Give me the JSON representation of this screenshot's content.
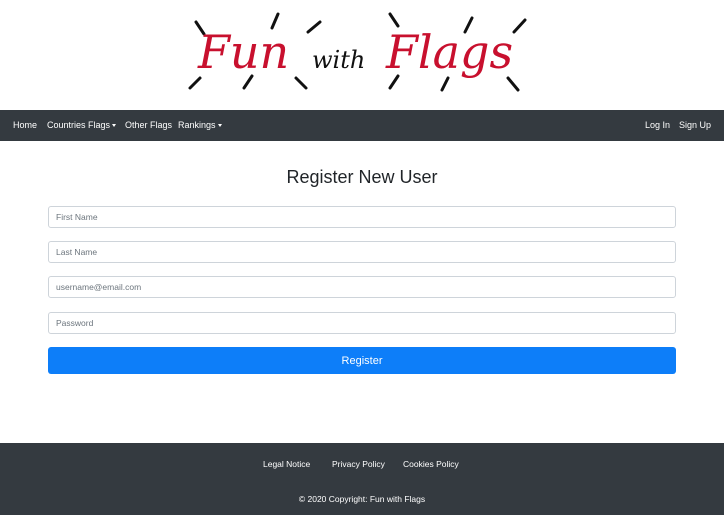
{
  "logo": {
    "word_left": "Fun",
    "word_middle": "with",
    "word_right": "Flags",
    "color_primary": "#c8102e",
    "color_rays": "#111111"
  },
  "nav": {
    "home": "Home",
    "countries_flags": "Countries Flags",
    "other_flags": "Other Flags",
    "rankings": "Rankings",
    "log_in": "Log In",
    "sign_up": "Sign Up",
    "caret_icon": "caret-down-icon"
  },
  "form": {
    "title": "Register New User",
    "first_name_placeholder": "First Name",
    "last_name_placeholder": "Last Name",
    "email_placeholder": "username@email.com",
    "password_placeholder": "Password",
    "register_label": "Register",
    "accent": "#0d7ef9"
  },
  "footer": {
    "legal_notice": "Legal Notice",
    "privacy_policy": "Privacy Policy",
    "cookies_policy": "Cookies Policy",
    "copyright": "© 2020 Copyright: Fun with Flags",
    "background": "#343a40"
  }
}
